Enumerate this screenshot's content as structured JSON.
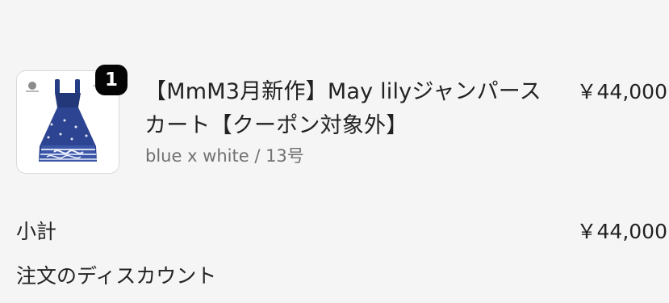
{
  "line_item": {
    "quantity": "1",
    "title": "【MmM3月新作】May lilyジャンパースカート【クーポン対象外】",
    "variant": "blue x white / 13号",
    "price": "￥44,000",
    "thumbnail_icon": "navy-jumper-skirt-product-image"
  },
  "summary": {
    "subtotal_label": "小計",
    "subtotal_value": "￥44,000",
    "discount_label": "注文のディスカウント"
  }
}
